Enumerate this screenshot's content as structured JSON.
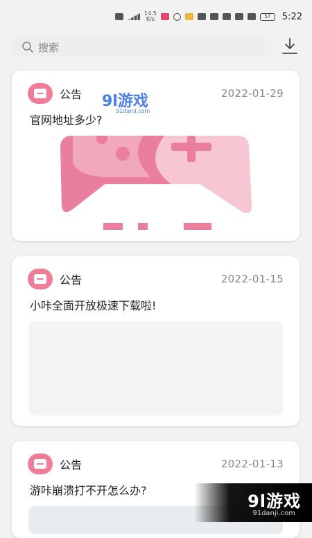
{
  "status": {
    "speed": "14.5\nK/s",
    "battery": "57",
    "time": "5:22"
  },
  "search": {
    "placeholder": "搜索"
  },
  "cards": [
    {
      "tag": "公告",
      "date": "2022-01-29",
      "title": "官网地址多少?"
    },
    {
      "tag": "公告",
      "date": "2022-01-15",
      "title": "小咔全面开放极速下载啦!"
    },
    {
      "tag": "公告",
      "date": "2022-01-13",
      "title": "游咔崩溃打不开怎么办?"
    }
  ],
  "watermark": {
    "text": "9l游戏",
    "sub": "91danji.com"
  },
  "watermark_top": {
    "text": "9l游戏",
    "sub": "91danji.com"
  },
  "colors": {
    "accent": "#ef7d97",
    "pink_light": "#f6c6d3",
    "pink_dark": "#ea7f9d"
  }
}
